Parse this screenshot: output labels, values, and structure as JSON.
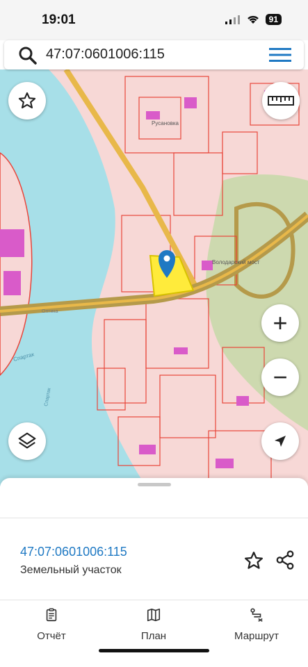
{
  "status_bar": {
    "time": "19:01",
    "battery": "91"
  },
  "search": {
    "query": "47:07:0601006:115"
  },
  "map": {
    "labels": {
      "district": "Русановка",
      "bridge": "Володарский мост",
      "station": "Спартак",
      "street": "Оптика",
      "street2": "Спартак"
    },
    "colors": {
      "water": "#a7dfe8",
      "parcel_fill": "#f7d8d6",
      "parcel_border": "#e8453a",
      "highlight": "#ffeb3b",
      "marker": "#1f79c3"
    }
  },
  "map_controls": {
    "zoom_in": "+",
    "zoom_out": "−"
  },
  "sheet": {
    "parcel_number": "47:07:0601006:115",
    "parcel_type": "Земельный участок"
  },
  "tabs": [
    {
      "label": "Отчёт",
      "icon": "report-icon"
    },
    {
      "label": "План",
      "icon": "map-icon"
    },
    {
      "label": "Маршрут",
      "icon": "route-icon"
    }
  ]
}
